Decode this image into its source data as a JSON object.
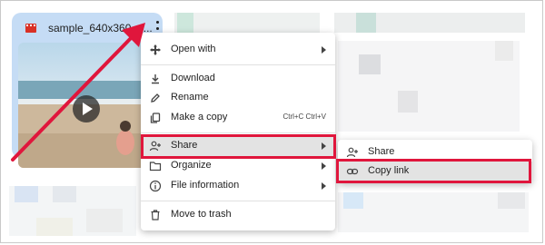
{
  "file_card": {
    "file_name": "sample_640x360.m..."
  },
  "context_menu": {
    "items": [
      {
        "label": "Open with",
        "icon": "move-icon",
        "has_submenu": true
      },
      {
        "label": "Download",
        "icon": "download-icon"
      },
      {
        "label": "Rename",
        "icon": "pencil-icon"
      },
      {
        "label": "Make a copy",
        "icon": "copy-icon",
        "shortcut": "Ctrl+C Ctrl+V"
      },
      {
        "label": "Share",
        "icon": "person-add-icon",
        "has_submenu": true,
        "highlighted": true
      },
      {
        "label": "Organize",
        "icon": "folder-icon",
        "has_submenu": true
      },
      {
        "label": "File information",
        "icon": "info-icon",
        "has_submenu": true
      },
      {
        "label": "Move to trash",
        "icon": "trash-icon"
      }
    ]
  },
  "share_submenu": {
    "items": [
      {
        "label": "Share",
        "icon": "person-add-icon"
      },
      {
        "label": "Copy link",
        "icon": "link-icon",
        "highlighted": true
      }
    ]
  },
  "colors": {
    "highlight_border": "#e0163c",
    "card_selected": "#c5dcf5",
    "hover_row": "#e3e3e3"
  }
}
